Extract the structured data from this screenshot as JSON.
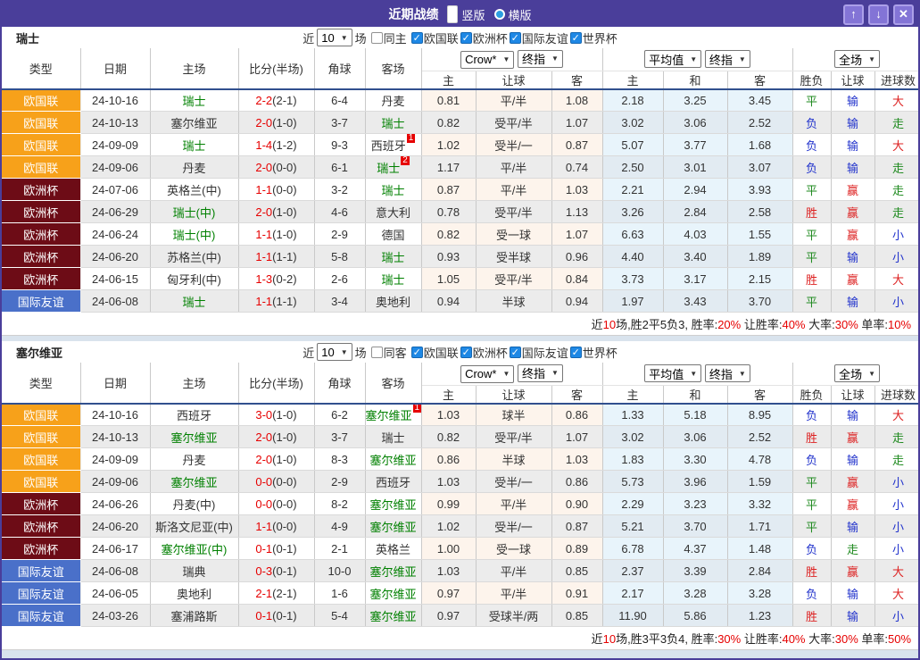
{
  "titlebar": {
    "title": "近期战绩",
    "layout_options": [
      {
        "label": "竖版",
        "selected": true
      },
      {
        "label": "横版",
        "selected": false
      }
    ],
    "window_buttons": [
      {
        "name": "up",
        "glyph": "↑"
      },
      {
        "name": "down",
        "glyph": "↓"
      },
      {
        "name": "close",
        "glyph": "✕"
      }
    ]
  },
  "table_header": {
    "cols": [
      "类型",
      "日期",
      "主场",
      "比分(半场)",
      "角球",
      "客场"
    ],
    "odds_group": {
      "select1": "Crow*",
      "select2": "终指",
      "subcols": [
        "主",
        "让球",
        "客"
      ]
    },
    "avg_group": {
      "select1": "平均值",
      "select2": "终指",
      "subcols": [
        "主",
        "和",
        "客"
      ]
    },
    "result_group": {
      "select1": "全场",
      "subcols": [
        "胜负",
        "让球",
        "进球数"
      ]
    }
  },
  "colors": {
    "league": {
      "欧国联": "#f7a11a",
      "欧洲杯": "#6d0c16",
      "国际友谊": "#4a70c9"
    },
    "result": {
      "胜": "#dd2222",
      "赢": "#dd2222",
      "大": "#dd2222",
      "平": "#1f8a1f",
      "走": "#1f8a1f",
      "负": "#2233cc",
      "输": "#2233cc",
      "小": "#2233cc"
    },
    "accent_purple": "#4a3e9a",
    "focus_team_green": "#008000",
    "score_red": "#e60000"
  },
  "sections": [
    {
      "team": "瑞士",
      "filter": {
        "near": "近",
        "count": "10",
        "games": "场",
        "same": {
          "label": "同主",
          "checked": false
        },
        "leagues": [
          {
            "label": "欧国联",
            "checked": true
          },
          {
            "label": "欧洲杯",
            "checked": true
          },
          {
            "label": "国际友谊",
            "checked": true
          },
          {
            "label": "世界杯",
            "checked": true
          }
        ]
      },
      "rows": [
        {
          "league": "欧国联",
          "date": "24-10-16",
          "home": "瑞士",
          "hf": true,
          "hs": "",
          "score": "2-2",
          "half": "(2-1)",
          "corner": "6-4",
          "away": "丹麦",
          "af": false,
          "as": "",
          "o": [
            "0.81",
            "平/半",
            "1.08"
          ],
          "a": [
            "2.18",
            "3.25",
            "3.45"
          ],
          "r": [
            "平",
            "输",
            "大"
          ]
        },
        {
          "league": "欧国联",
          "date": "24-10-13",
          "home": "塞尔维亚",
          "hf": false,
          "hs": "",
          "score": "2-0",
          "half": "(1-0)",
          "corner": "3-7",
          "away": "瑞士",
          "af": true,
          "as": "",
          "o": [
            "0.82",
            "受平/半",
            "1.07"
          ],
          "a": [
            "3.02",
            "3.06",
            "2.52"
          ],
          "r": [
            "负",
            "输",
            "走"
          ]
        },
        {
          "league": "欧国联",
          "date": "24-09-09",
          "home": "瑞士",
          "hf": true,
          "hs": "",
          "score": "1-4",
          "half": "(1-2)",
          "corner": "9-3",
          "away": "西班牙",
          "af": false,
          "as": "1",
          "o": [
            "1.02",
            "受半/一",
            "0.87"
          ],
          "a": [
            "5.07",
            "3.77",
            "1.68"
          ],
          "r": [
            "负",
            "输",
            "大"
          ]
        },
        {
          "league": "欧国联",
          "date": "24-09-06",
          "home": "丹麦",
          "hf": false,
          "hs": "",
          "score": "2-0",
          "half": "(0-0)",
          "corner": "6-1",
          "away": "瑞士",
          "af": true,
          "as": "2",
          "o": [
            "1.17",
            "平/半",
            "0.74"
          ],
          "a": [
            "2.50",
            "3.01",
            "3.07"
          ],
          "r": [
            "负",
            "输",
            "走"
          ]
        },
        {
          "league": "欧洲杯",
          "date": "24-07-06",
          "home": "英格兰(中)",
          "hf": false,
          "hs": "",
          "score": "1-1",
          "half": "(0-0)",
          "corner": "3-2",
          "away": "瑞士",
          "af": true,
          "as": "",
          "o": [
            "0.87",
            "平/半",
            "1.03"
          ],
          "a": [
            "2.21",
            "2.94",
            "3.93"
          ],
          "r": [
            "平",
            "赢",
            "走"
          ]
        },
        {
          "league": "欧洲杯",
          "date": "24-06-29",
          "home": "瑞士(中)",
          "hf": true,
          "hs": "",
          "score": "2-0",
          "half": "(1-0)",
          "corner": "4-6",
          "away": "意大利",
          "af": false,
          "as": "",
          "o": [
            "0.78",
            "受平/半",
            "1.13"
          ],
          "a": [
            "3.26",
            "2.84",
            "2.58"
          ],
          "r": [
            "胜",
            "赢",
            "走"
          ]
        },
        {
          "league": "欧洲杯",
          "date": "24-06-24",
          "home": "瑞士(中)",
          "hf": true,
          "hs": "",
          "score": "1-1",
          "half": "(1-0)",
          "corner": "2-9",
          "away": "德国",
          "af": false,
          "as": "",
          "o": [
            "0.82",
            "受一球",
            "1.07"
          ],
          "a": [
            "6.63",
            "4.03",
            "1.55"
          ],
          "r": [
            "平",
            "赢",
            "小"
          ]
        },
        {
          "league": "欧洲杯",
          "date": "24-06-20",
          "home": "苏格兰(中)",
          "hf": false,
          "hs": "",
          "score": "1-1",
          "half": "(1-1)",
          "corner": "5-8",
          "away": "瑞士",
          "af": true,
          "as": "",
          "o": [
            "0.93",
            "受半球",
            "0.96"
          ],
          "a": [
            "4.40",
            "3.40",
            "1.89"
          ],
          "r": [
            "平",
            "输",
            "小"
          ]
        },
        {
          "league": "欧洲杯",
          "date": "24-06-15",
          "home": "匈牙利(中)",
          "hf": false,
          "hs": "",
          "score": "1-3",
          "half": "(0-2)",
          "corner": "2-6",
          "away": "瑞士",
          "af": true,
          "as": "",
          "o": [
            "1.05",
            "受平/半",
            "0.84"
          ],
          "a": [
            "3.73",
            "3.17",
            "2.15"
          ],
          "r": [
            "胜",
            "赢",
            "大"
          ]
        },
        {
          "league": "国际友谊",
          "date": "24-06-08",
          "home": "瑞士",
          "hf": true,
          "hs": "",
          "score": "1-1",
          "half": "(1-1)",
          "corner": "3-4",
          "away": "奥地利",
          "af": false,
          "as": "",
          "o": [
            "0.94",
            "半球",
            "0.94"
          ],
          "a": [
            "1.97",
            "3.43",
            "3.70"
          ],
          "r": [
            "平",
            "输",
            "小"
          ]
        }
      ],
      "summary": [
        {
          "t": "近",
          "red": false
        },
        {
          "t": "10",
          "red": true
        },
        {
          "t": "场,胜2平5负3, 胜率:",
          "red": false
        },
        {
          "t": "20%",
          "red": true
        },
        {
          "t": " 让胜率:",
          "red": false
        },
        {
          "t": "40%",
          "red": true
        },
        {
          "t": " 大率:",
          "red": false
        },
        {
          "t": "30%",
          "red": true
        },
        {
          "t": " 单率:",
          "red": false
        },
        {
          "t": "10%",
          "red": true
        }
      ]
    },
    {
      "team": "塞尔维亚",
      "filter": {
        "near": "近",
        "count": "10",
        "games": "场",
        "same": {
          "label": "同客",
          "checked": false
        },
        "leagues": [
          {
            "label": "欧国联",
            "checked": true
          },
          {
            "label": "欧洲杯",
            "checked": true
          },
          {
            "label": "国际友谊",
            "checked": true
          },
          {
            "label": "世界杯",
            "checked": true
          }
        ]
      },
      "rows": [
        {
          "league": "欧国联",
          "date": "24-10-16",
          "home": "西班牙",
          "hf": false,
          "hs": "",
          "score": "3-0",
          "half": "(1-0)",
          "corner": "6-2",
          "away": "塞尔维亚",
          "af": true,
          "as": "1",
          "o": [
            "1.03",
            "球半",
            "0.86"
          ],
          "a": [
            "1.33",
            "5.18",
            "8.95"
          ],
          "r": [
            "负",
            "输",
            "大"
          ]
        },
        {
          "league": "欧国联",
          "date": "24-10-13",
          "home": "塞尔维亚",
          "hf": true,
          "hs": "",
          "score": "2-0",
          "half": "(1-0)",
          "corner": "3-7",
          "away": "瑞士",
          "af": false,
          "as": "",
          "o": [
            "0.82",
            "受平/半",
            "1.07"
          ],
          "a": [
            "3.02",
            "3.06",
            "2.52"
          ],
          "r": [
            "胜",
            "赢",
            "走"
          ]
        },
        {
          "league": "欧国联",
          "date": "24-09-09",
          "home": "丹麦",
          "hf": false,
          "hs": "",
          "score": "2-0",
          "half": "(1-0)",
          "corner": "8-3",
          "away": "塞尔维亚",
          "af": true,
          "as": "",
          "o": [
            "0.86",
            "半球",
            "1.03"
          ],
          "a": [
            "1.83",
            "3.30",
            "4.78"
          ],
          "r": [
            "负",
            "输",
            "走"
          ]
        },
        {
          "league": "欧国联",
          "date": "24-09-06",
          "home": "塞尔维亚",
          "hf": true,
          "hs": "",
          "score": "0-0",
          "half": "(0-0)",
          "corner": "2-9",
          "away": "西班牙",
          "af": false,
          "as": "",
          "o": [
            "1.03",
            "受半/一",
            "0.86"
          ],
          "a": [
            "5.73",
            "3.96",
            "1.59"
          ],
          "r": [
            "平",
            "赢",
            "小"
          ]
        },
        {
          "league": "欧洲杯",
          "date": "24-06-26",
          "home": "丹麦(中)",
          "hf": false,
          "hs": "",
          "score": "0-0",
          "half": "(0-0)",
          "corner": "8-2",
          "away": "塞尔维亚",
          "af": true,
          "as": "",
          "o": [
            "0.99",
            "平/半",
            "0.90"
          ],
          "a": [
            "2.29",
            "3.23",
            "3.32"
          ],
          "r": [
            "平",
            "赢",
            "小"
          ]
        },
        {
          "league": "欧洲杯",
          "date": "24-06-20",
          "home": "斯洛文尼亚(中)",
          "hf": false,
          "hs": "",
          "score": "1-1",
          "half": "(0-0)",
          "corner": "4-9",
          "away": "塞尔维亚",
          "af": true,
          "as": "",
          "o": [
            "1.02",
            "受半/一",
            "0.87"
          ],
          "a": [
            "5.21",
            "3.70",
            "1.71"
          ],
          "r": [
            "平",
            "输",
            "小"
          ]
        },
        {
          "league": "欧洲杯",
          "date": "24-06-17",
          "home": "塞尔维亚(中)",
          "hf": true,
          "hs": "",
          "score": "0-1",
          "half": "(0-1)",
          "corner": "2-1",
          "away": "英格兰",
          "af": false,
          "as": "",
          "o": [
            "1.00",
            "受一球",
            "0.89"
          ],
          "a": [
            "6.78",
            "4.37",
            "1.48"
          ],
          "r": [
            "负",
            "走",
            "小"
          ]
        },
        {
          "league": "国际友谊",
          "date": "24-06-08",
          "home": "瑞典",
          "hf": false,
          "hs": "",
          "score": "0-3",
          "half": "(0-1)",
          "corner": "10-0",
          "away": "塞尔维亚",
          "af": true,
          "as": "",
          "o": [
            "1.03",
            "平/半",
            "0.85"
          ],
          "a": [
            "2.37",
            "3.39",
            "2.84"
          ],
          "r": [
            "胜",
            "赢",
            "大"
          ]
        },
        {
          "league": "国际友谊",
          "date": "24-06-05",
          "home": "奥地利",
          "hf": false,
          "hs": "",
          "score": "2-1",
          "half": "(2-1)",
          "corner": "1-6",
          "away": "塞尔维亚",
          "af": true,
          "as": "",
          "o": [
            "0.97",
            "平/半",
            "0.91"
          ],
          "a": [
            "2.17",
            "3.28",
            "3.28"
          ],
          "r": [
            "负",
            "输",
            "大"
          ]
        },
        {
          "league": "国际友谊",
          "date": "24-03-26",
          "home": "塞浦路斯",
          "hf": false,
          "hs": "",
          "score": "0-1",
          "half": "(0-1)",
          "corner": "5-4",
          "away": "塞尔维亚",
          "af": true,
          "as": "",
          "o": [
            "0.97",
            "受球半/两",
            "0.85"
          ],
          "a": [
            "11.90",
            "5.86",
            "1.23"
          ],
          "r": [
            "胜",
            "输",
            "小"
          ]
        }
      ],
      "summary": [
        {
          "t": "近",
          "red": false
        },
        {
          "t": "10",
          "red": true
        },
        {
          "t": "场,胜3平3负4, 胜率:",
          "red": false
        },
        {
          "t": "30%",
          "red": true
        },
        {
          "t": " 让胜率:",
          "red": false
        },
        {
          "t": "40%",
          "red": true
        },
        {
          "t": " 大率:",
          "red": false
        },
        {
          "t": "30%",
          "red": true
        },
        {
          "t": " 单率:",
          "red": false
        },
        {
          "t": "50%",
          "red": true
        }
      ]
    }
  ]
}
